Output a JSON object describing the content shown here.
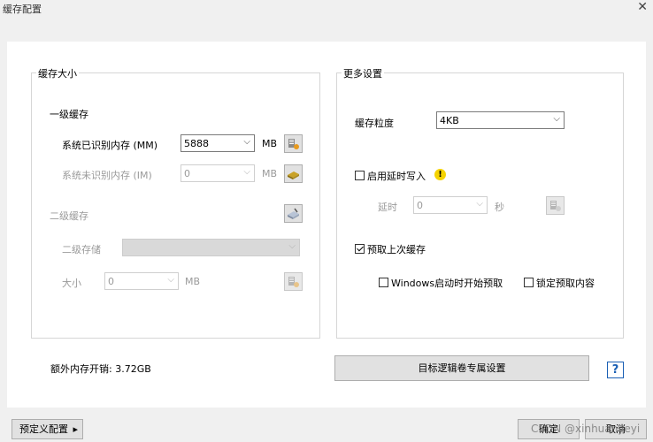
{
  "window": {
    "title": "缓存配置",
    "close_glyph": "✕"
  },
  "cache_size": {
    "group_title": "缓存大小",
    "l1_title": "一级缓存",
    "recognized_label": "系统已识别内存 (MM)",
    "recognized_value": "5888",
    "recognized_unit": "MB",
    "unrecognized_label": "系统未识别内存 (IM)",
    "unrecognized_value": "0",
    "unrecognized_unit": "MB",
    "l2_title": "二级缓存",
    "l2_storage_label": "二级存储",
    "l2_storage_value": "",
    "l2_size_label": "大小",
    "l2_size_value": "0",
    "l2_size_unit": "MB"
  },
  "more_settings": {
    "group_title": "更多设置",
    "granularity_label": "缓存粒度",
    "granularity_value": "4KB",
    "delayed_write_label": "启用延时写入",
    "delayed_write_checked": false,
    "delay_label": "延时",
    "delay_value": "0",
    "delay_unit": "秒",
    "prefetch_label": "预取上次缓存",
    "prefetch_checked": true,
    "windows_prefetch_label": "Windows启动时开始预取",
    "lock_prefetch_label": "锁定预取内容"
  },
  "footer": {
    "extra_memory": "额外内存开销: 3.72GB",
    "target_volume_button": "目标逻辑卷专属设置",
    "help_glyph": "?",
    "preset_button": "预定义配置",
    "preset_arrow": "▸",
    "ok_button": "确定",
    "cancel_button": "取消",
    "watermark": "CSDN @xinhuanyeyi"
  },
  "icons": [
    "memory-icon",
    "drive-icon",
    "disk-icon",
    "warning-icon"
  ]
}
